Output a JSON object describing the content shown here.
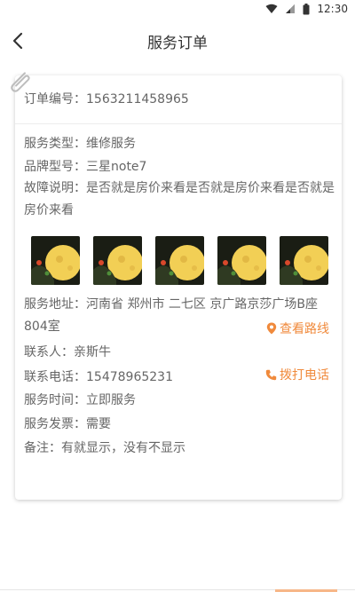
{
  "status_bar": {
    "time": "12:30",
    "icons": [
      "wifi-icon",
      "signal-icon",
      "battery-icon"
    ]
  },
  "header": {
    "back_icon": "chevron-left-icon",
    "title": "服务订单"
  },
  "order": {
    "number_label": "订单编号：",
    "number_value": "1563211458965"
  },
  "details": {
    "service_type_label": "服务类型：",
    "service_type_value": "维修服务",
    "brand_label": "品牌型号：",
    "brand_value": "三星note7",
    "fault_label": "故障说明：",
    "fault_value": "是否就是房价来看是否就是房价来看是否就是房价来看",
    "images": [
      "moon-photo",
      "moon-photo",
      "moon-photo",
      "moon-photo",
      "moon-photo"
    ],
    "address_label": "服务地址：",
    "address_value": "河南省 郑州市 二七区 京广路京莎广场B座804室",
    "route_label": "查看路线",
    "contact_label": "联系人：",
    "contact_value": "亲斯牛",
    "phone_label": "联系电话：",
    "phone_value": "15478965231",
    "call_label": "拨打电话",
    "time_label": "服务时间：",
    "time_value": "立即服务",
    "invoice_label": "服务发票：",
    "invoice_value": "需要",
    "note_label": "备注：",
    "note_value": "有就显示，没有不显示"
  },
  "colors": {
    "accent": "#f08a3c",
    "text": "#666666",
    "title": "#333333"
  }
}
